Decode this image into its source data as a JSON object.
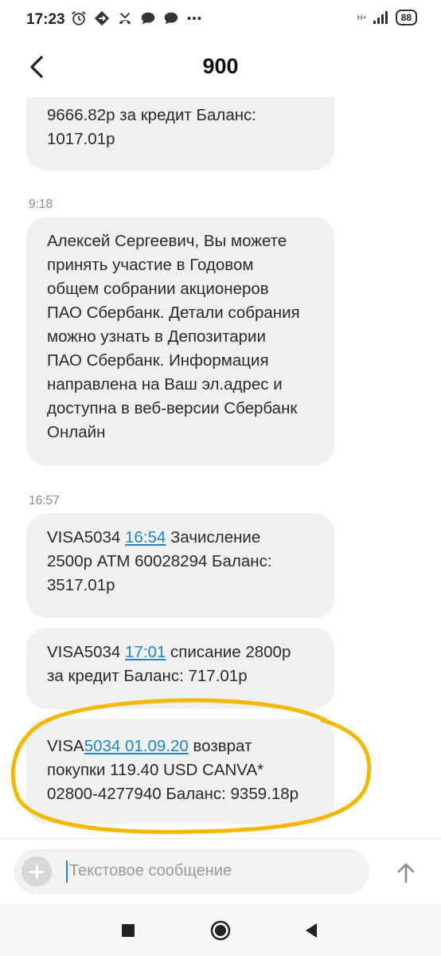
{
  "status_bar": {
    "time": "17:23",
    "network": "H+",
    "battery": "88"
  },
  "header": {
    "title": "900"
  },
  "messages": [
    {
      "lines": [
        "9666.82р за кредит Баланс:",
        "1017.01р"
      ]
    },
    {
      "time": "9:18",
      "lines": [
        "Алексей Сергеевич, Вы можете",
        "принять участие в Годовом",
        "общем собрании акционеров",
        "ПАО Сбербанк. Детали собрания",
        "можно узнать в Депозитарии",
        "ПАО Сбербанк. Информация",
        "направлена на Ваш эл.адрес и",
        "доступна в веб-версии Сбербанк",
        "Онлайн"
      ]
    },
    {
      "time": "16:57",
      "prefix": "VISA5034 ",
      "link": "16:54",
      "after_link": " Зачисление",
      "lines": [
        "2500р ATM 60028294 Баланс:",
        "3517.01р"
      ]
    },
    {
      "prefix": "VISA5034 ",
      "link": "17:01",
      "after_link": " списание 2800р",
      "lines": [
        "за кредит Баланс: 717.01р"
      ]
    },
    {
      "prefix": "VISA",
      "link": "5034 01.09.20",
      "after_link": " возврат",
      "lines": [
        "покупки 119.40 USD CANVA*",
        "02800-4277940 Баланс: 9359.18р"
      ]
    }
  ],
  "composer": {
    "placeholder": "Текстовое сообщение"
  },
  "colors": {
    "link": "#1e88c7",
    "bubble": "#f0f0f0",
    "highlight": "#f5b800"
  },
  "icons": [
    "alarm-icon",
    "vpn-key-icon",
    "missed-call-icon",
    "chat-icon",
    "chat-icon",
    "more-icon",
    "signal-icon",
    "back-arrow-icon",
    "add-icon",
    "send-icon",
    "home-icon",
    "recents-icon",
    "back-icon"
  ]
}
